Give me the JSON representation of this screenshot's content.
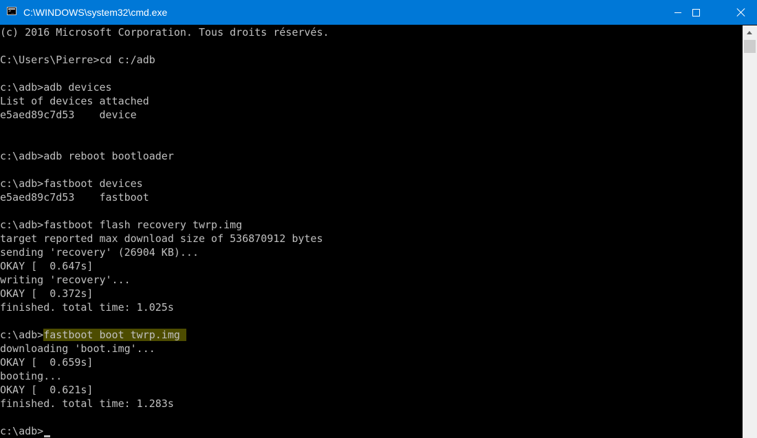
{
  "window": {
    "title": "C:\\WINDOWS\\system32\\cmd.exe",
    "icon": "cmd-icon",
    "controls": {
      "minimize": "minimize-icon",
      "maximize": "maximize-icon",
      "close": "close-icon"
    }
  },
  "console": {
    "line1": "(c) 2016 Microsoft Corporation. Tous droits réservés.",
    "line3": "C:\\Users\\Pierre>cd c:/adb",
    "line5": "c:\\adb>adb devices",
    "line6": "List of devices attached",
    "line7": "e5aed89c7d53    device",
    "line10": "c:\\adb>adb reboot bootloader",
    "line12": "c:\\adb>fastboot devices",
    "line13": "e5aed89c7d53    fastboot",
    "line15": "c:\\adb>fastboot flash recovery twrp.img",
    "line16": "target reported max download size of 536870912 bytes",
    "line17": "sending 'recovery' (26904 KB)...",
    "line18": "OKAY [  0.647s]",
    "line19": "writing 'recovery'...",
    "line20": "OKAY [  0.372s]",
    "line21": "finished. total time: 1.025s",
    "line23_prompt": "c:\\adb>",
    "line23_command": "fastboot boot twrp.img ",
    "line24": "downloading 'boot.img'...",
    "line25": "OKAY [  0.659s]",
    "line26": "booting...",
    "line27": "OKAY [  0.621s]",
    "line28": "finished. total time: 1.283s",
    "line30_prompt": "c:\\adb>"
  },
  "colors": {
    "titlebar": "#0078d7",
    "console_bg": "#000000",
    "console_text": "#c0c0c0",
    "highlight": "#4d4c00"
  }
}
